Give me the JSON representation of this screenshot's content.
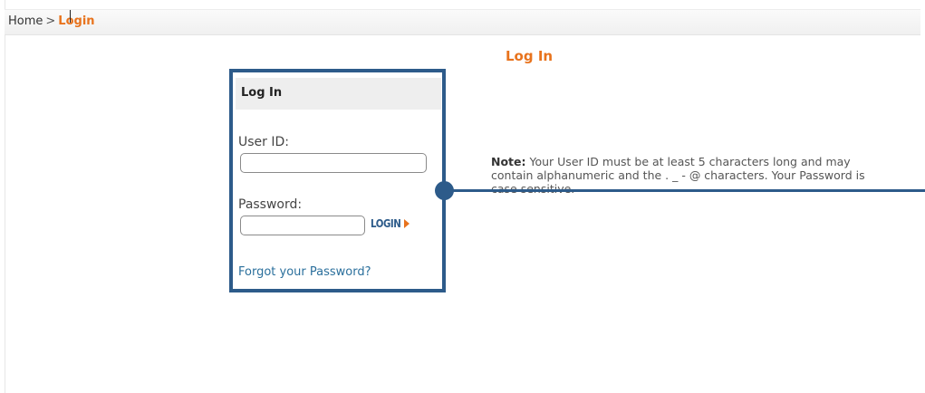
{
  "breadcrumb": {
    "home": "Home",
    "separator": ">",
    "current": "Login"
  },
  "page_title": "Log In",
  "login_box": {
    "header": "Log In",
    "user_id_label": "User ID:",
    "user_id_value": "",
    "password_label": "Password:",
    "password_value": "",
    "login_button_label": "LOGIN",
    "forgot_password": "Forgot your Password?"
  },
  "note": {
    "label": "Note:",
    "text": "Your User ID must be at least 5 characters long and may contain alphanumeric and the . _ - @ characters. Your Password is case sensitive."
  },
  "colors": {
    "accent_orange": "#e8731d",
    "callout_blue": "#2d5b8a",
    "link_blue": "#2a6f9c"
  },
  "icons": {
    "login_arrow": "arrow-right-icon"
  }
}
